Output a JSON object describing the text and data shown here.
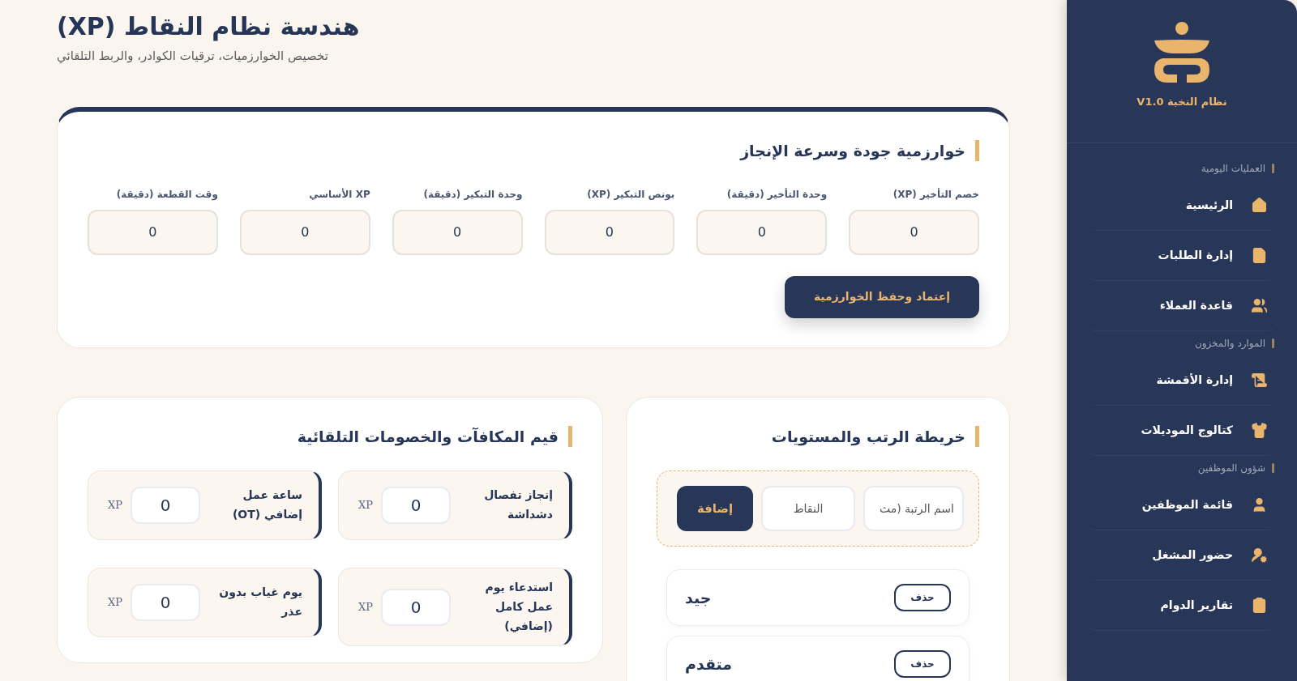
{
  "header": {
    "title": "هندسة نظام النقاط (XP)",
    "subtitle": "تخصيص الخوارزميات، ترقيات الكوادر، والربط التلقائي"
  },
  "algorithm": {
    "title": "خوارزمية جودة وسرعة الإنجاز",
    "fields": [
      {
        "label": "خصم التأخير (XP)",
        "value": "0"
      },
      {
        "label": "وحدة التأخير (دقيقة)",
        "value": "0"
      },
      {
        "label": "بونص التبكير (XP)",
        "value": "0"
      },
      {
        "label": "وحدة التبكير (دقيقة)",
        "value": "0"
      },
      {
        "label": "XP الأساسي",
        "value": "0"
      },
      {
        "label": "وقت القطعة (دقيقة)",
        "value": "0"
      }
    ],
    "button": "إعتماد وحفظ الخوارزمية"
  },
  "ranks": {
    "title": "خريطة الرتب والمستويات",
    "form": {
      "name_placeholder": "اسم الرتبة (مث",
      "points_placeholder": "النقاط",
      "button": "إضافة"
    },
    "items": [
      {
        "name": "جيد",
        "delete": "حذف"
      },
      {
        "name": "متقدم",
        "delete": "حذف"
      }
    ]
  },
  "rewards": {
    "title": "قيم المكافآت والخصومات التلقائية",
    "items": [
      {
        "label": "إنجاز تفصال دشداشة",
        "value": "0",
        "unit": "XP"
      },
      {
        "label": "ساعة عمل إضافي (OT)",
        "value": "0",
        "unit": "XP"
      },
      {
        "label": "استدعاء يوم عمل كامل (إضافي)",
        "value": "0",
        "unit": "XP"
      },
      {
        "label": "يوم غياب بدون عذر",
        "value": "0",
        "unit": "XP"
      }
    ]
  },
  "sidebar": {
    "brand": "نظام النخبة V1.0",
    "sections": [
      {
        "title": "العمليات اليومية",
        "items": [
          {
            "label": "الرئيسية"
          },
          {
            "label": "إدارة الطلبات"
          },
          {
            "label": "قاعدة العملاء"
          }
        ]
      },
      {
        "title": "الموارد والمخزون",
        "items": [
          {
            "label": "إدارة الأقمشة"
          },
          {
            "label": "كتالوج الموديلات"
          }
        ]
      },
      {
        "title": "شؤون الموظفين",
        "items": [
          {
            "label": "قائمة الموظفين"
          },
          {
            "label": "حضور المشغل"
          },
          {
            "label": "تقارير الدوام"
          }
        ]
      }
    ]
  }
}
